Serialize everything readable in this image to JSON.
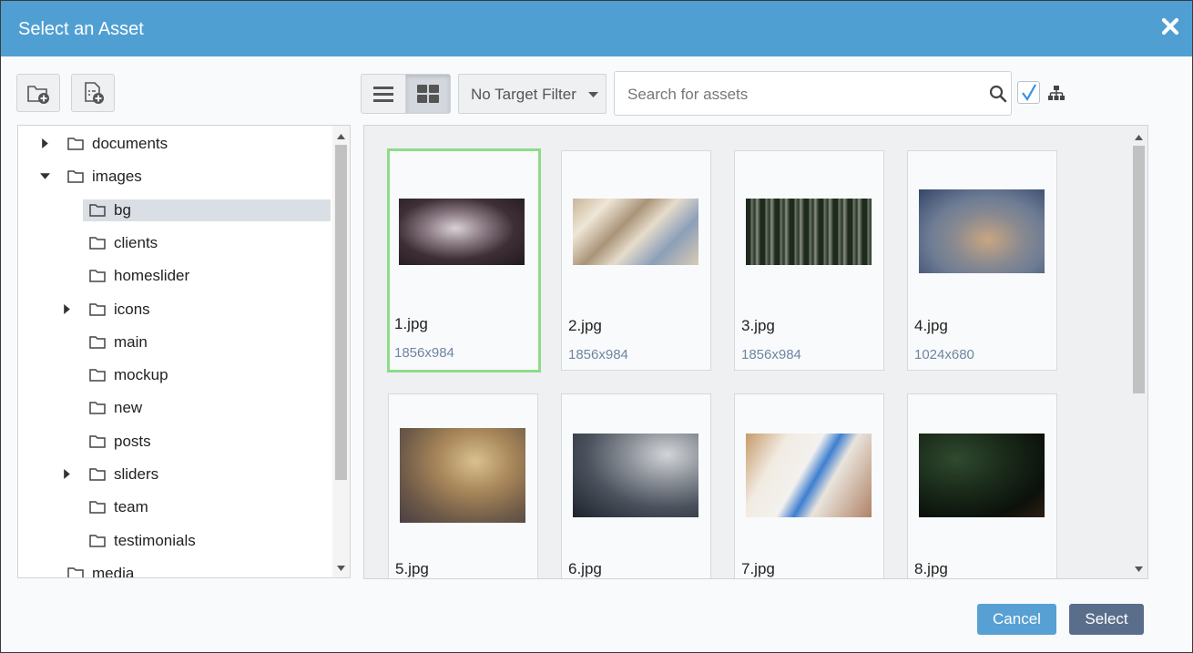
{
  "dialog": {
    "title": "Select an Asset",
    "close_icon": "close-icon"
  },
  "toolbar": {
    "new_folder_icon": "folder-plus-icon",
    "new_file_icon": "file-plus-icon",
    "list_view_icon": "list-view-icon",
    "grid_view_icon": "grid-view-icon",
    "active_view": "grid",
    "filter_label": "No Target Filter",
    "search_placeholder": "Search for assets",
    "search_value": "",
    "checkbox_checked": true,
    "tree_toggle_icon": "sitemap-icon"
  },
  "tree": {
    "items": [
      {
        "label": "documents",
        "depth": 0,
        "caret": "right",
        "selected": false
      },
      {
        "label": "images",
        "depth": 0,
        "caret": "down",
        "selected": false
      },
      {
        "label": "bg",
        "depth": 1,
        "caret": "none",
        "selected": true
      },
      {
        "label": "clients",
        "depth": 1,
        "caret": "none",
        "selected": false
      },
      {
        "label": "homeslider",
        "depth": 1,
        "caret": "none",
        "selected": false
      },
      {
        "label": "icons",
        "depth": 1,
        "caret": "right",
        "selected": false
      },
      {
        "label": "main",
        "depth": 1,
        "caret": "none",
        "selected": false
      },
      {
        "label": "mockup",
        "depth": 1,
        "caret": "none",
        "selected": false
      },
      {
        "label": "new",
        "depth": 1,
        "caret": "none",
        "selected": false
      },
      {
        "label": "posts",
        "depth": 1,
        "caret": "none",
        "selected": false
      },
      {
        "label": "sliders",
        "depth": 1,
        "caret": "right",
        "selected": false
      },
      {
        "label": "team",
        "depth": 1,
        "caret": "none",
        "selected": false
      },
      {
        "label": "testimonials",
        "depth": 1,
        "caret": "none",
        "selected": false
      },
      {
        "label": "media",
        "depth": 0,
        "caret": "none",
        "selected": false
      }
    ]
  },
  "assets": {
    "items": [
      {
        "name": "1.jpg",
        "dims": "1856x984",
        "selected": true
      },
      {
        "name": "2.jpg",
        "dims": "1856x984",
        "selected": false
      },
      {
        "name": "3.jpg",
        "dims": "1856x984",
        "selected": false
      },
      {
        "name": "4.jpg",
        "dims": "1024x680",
        "selected": false
      },
      {
        "name": "5.jpg",
        "dims": "",
        "selected": false
      },
      {
        "name": "6.jpg",
        "dims": "",
        "selected": false
      },
      {
        "name": "7.jpg",
        "dims": "",
        "selected": false
      },
      {
        "name": "8.jpg",
        "dims": "",
        "selected": false
      }
    ]
  },
  "footer": {
    "cancel_label": "Cancel",
    "select_label": "Select"
  },
  "colors": {
    "title_bar": "#509fd3",
    "selected_border": "#8edb8a",
    "cancel_button": "#57a0d4",
    "select_button": "#5a6e8c",
    "dims_text": "#6f85a1"
  }
}
